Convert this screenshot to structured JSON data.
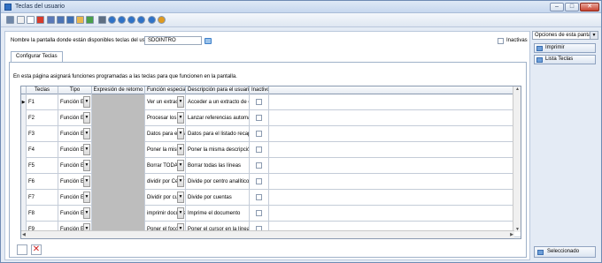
{
  "window": {
    "title": "Teclas del usuario",
    "min": "–",
    "max": "□",
    "close": "✕"
  },
  "toolbar": {
    "icons": [
      {
        "name": "options-dropdown-icon",
        "color": "#6f87a8"
      },
      {
        "name": "new-document-icon",
        "color": "#f0f0f0"
      },
      {
        "name": "copy-icon",
        "color": "#ffffff"
      },
      {
        "name": "delete-icon",
        "color": "#d83b2b"
      },
      {
        "name": "window-icon",
        "color": "#5a79b8"
      },
      {
        "name": "grid-icon",
        "color": "#4c74b5"
      },
      {
        "name": "save-icon",
        "color": "#3e6fb4"
      },
      {
        "name": "folder-icon",
        "color": "#e8b64c"
      },
      {
        "name": "export-icon",
        "color": "#4aa04a"
      },
      {
        "name": "search-icon",
        "color": "#5f6f82"
      },
      {
        "name": "first-record-icon",
        "color": "#2f72c7"
      },
      {
        "name": "previous-record-icon",
        "color": "#2f72c7"
      },
      {
        "name": "next-record-icon",
        "color": "#2f72c7"
      },
      {
        "name": "last-record-icon",
        "color": "#2f72c7"
      },
      {
        "name": "refresh-icon",
        "color": "#2f72c7"
      },
      {
        "name": "help-icon",
        "color": "#e09a1f"
      }
    ]
  },
  "screen": {
    "label": "Nombre la pantalla donde están disponibles teclas del usuario",
    "value": "SDOINTRO",
    "inactive_label": "Inactivas"
  },
  "tabs": [
    {
      "label": "Configurar Teclas"
    }
  ],
  "tab_description": "En esta página asignará funciones programadas a las teclas para que funcionen en la pantalla.",
  "grid": {
    "headers": [
      "Teclas",
      "Tipo",
      "Expresión de retorno",
      "Función especial",
      "Descripción para el usuario",
      "Inactivo"
    ],
    "rows": [
      {
        "key": "F1",
        "tipo": "Función Es",
        "funcion": "Ver un extracto",
        "desc": "Acceder a un extracto de cue"
      },
      {
        "key": "F2",
        "tipo": "Función Es",
        "funcion": "Procesar los ret",
        "desc": "Lanzar referencias automátic"
      },
      {
        "key": "F3",
        "tipo": "Función Es",
        "funcion": "Datos para el lis",
        "desc": "Datos para el listado recapitul"
      },
      {
        "key": "F4",
        "tipo": "Función Es",
        "funcion": "Poner la misma",
        "desc": "Poner la misma descripción en"
      },
      {
        "key": "F5",
        "tipo": "Función Es",
        "funcion": "Borrar TODAS l",
        "desc": "Borrar todas las líneas"
      },
      {
        "key": "F6",
        "tipo": "Función Es",
        "funcion": "dividir por Centr",
        "desc": "Divide por centro analítico"
      },
      {
        "key": "F7",
        "tipo": "Función Es",
        "funcion": "Dividir por cuen",
        "desc": "Divide por cuentas"
      },
      {
        "key": "F8",
        "tipo": "Función Es",
        "funcion": "imprimir docume",
        "desc": "Imprime el documento"
      },
      {
        "key": "F9",
        "tipo": "Función Es",
        "funcion": "Poner el foco e",
        "desc": "Poner el cursor en la líneas de"
      }
    ]
  },
  "side": {
    "options_label": "Opciones de esta pantalla",
    "print_label": "Imprimir",
    "list_keys_label": "Lista Teclas",
    "selected_label": "Seleccionado"
  }
}
